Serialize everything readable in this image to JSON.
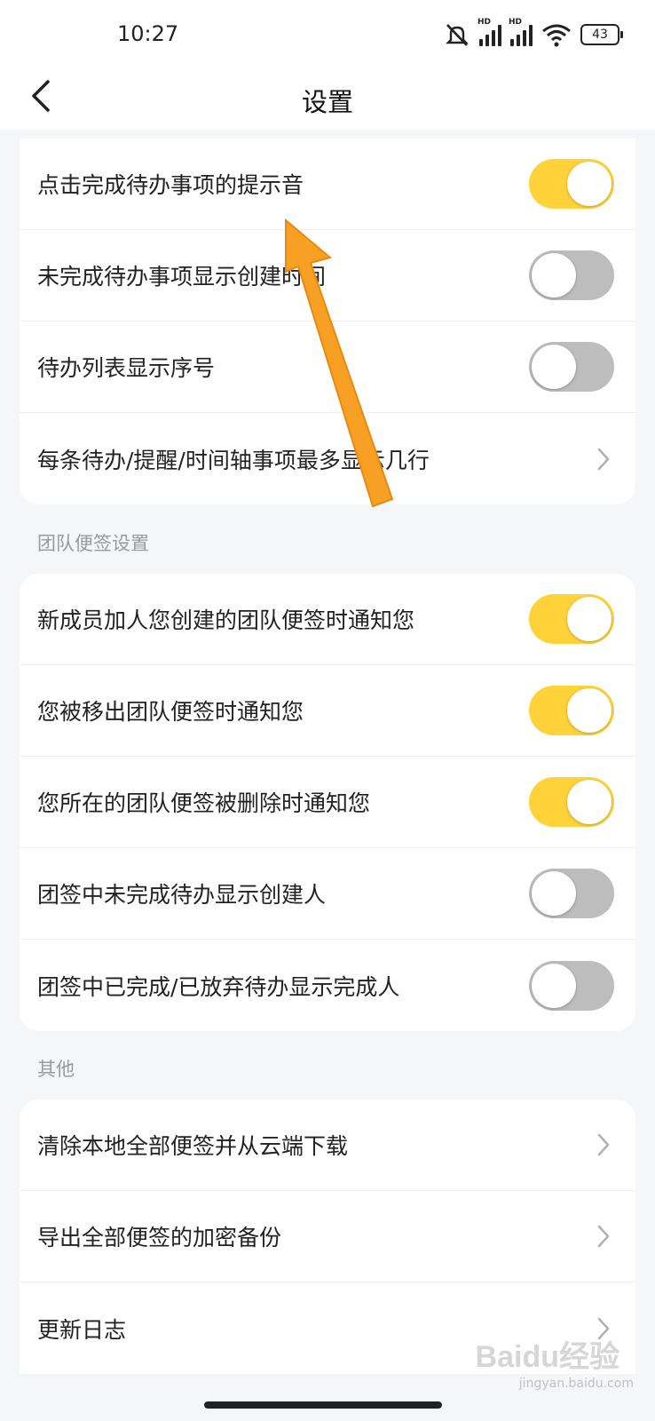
{
  "status_bar": {
    "time": "10:27",
    "battery": "43",
    "hd_label": "HD"
  },
  "header": {
    "title": "设置"
  },
  "card1": {
    "rows": [
      {
        "label": "点击完成待办事项的提示音",
        "control": "toggle",
        "on": true
      },
      {
        "label": "未完成待办事项显示创建时间",
        "control": "toggle",
        "on": false
      },
      {
        "label": "待办列表显示序号",
        "control": "toggle",
        "on": false
      },
      {
        "label": "每条待办/提醒/时间轴事项最多显示几行",
        "control": "chevron"
      }
    ]
  },
  "team_section": {
    "title": "团队便签设置",
    "rows": [
      {
        "label": "新成员加人您创建的团队便签时通知您",
        "control": "toggle",
        "on": true
      },
      {
        "label": "您被移出团队便签时通知您",
        "control": "toggle",
        "on": true
      },
      {
        "label": "您所在的团队便签被删除时通知您",
        "control": "toggle",
        "on": true
      },
      {
        "label": "团签中未完成待办显示创建人",
        "control": "toggle",
        "on": false
      },
      {
        "label": "团签中已完成/已放弃待办显示完成人",
        "control": "toggle",
        "on": false
      }
    ]
  },
  "other_section": {
    "title": "其他",
    "rows": [
      {
        "label": "清除本地全部便签并从云端下载",
        "control": "chevron"
      },
      {
        "label": "导出全部便签的加密备份",
        "control": "chevron"
      },
      {
        "label": "更新日志",
        "control": "chevron"
      }
    ]
  },
  "watermark": {
    "text": "Baidu经验",
    "url": "jingyan.baidu.com"
  },
  "colors": {
    "toggle_on": "#ffd23a",
    "toggle_off": "#bdbdbd",
    "annotation_arrow": "#f7a023"
  }
}
